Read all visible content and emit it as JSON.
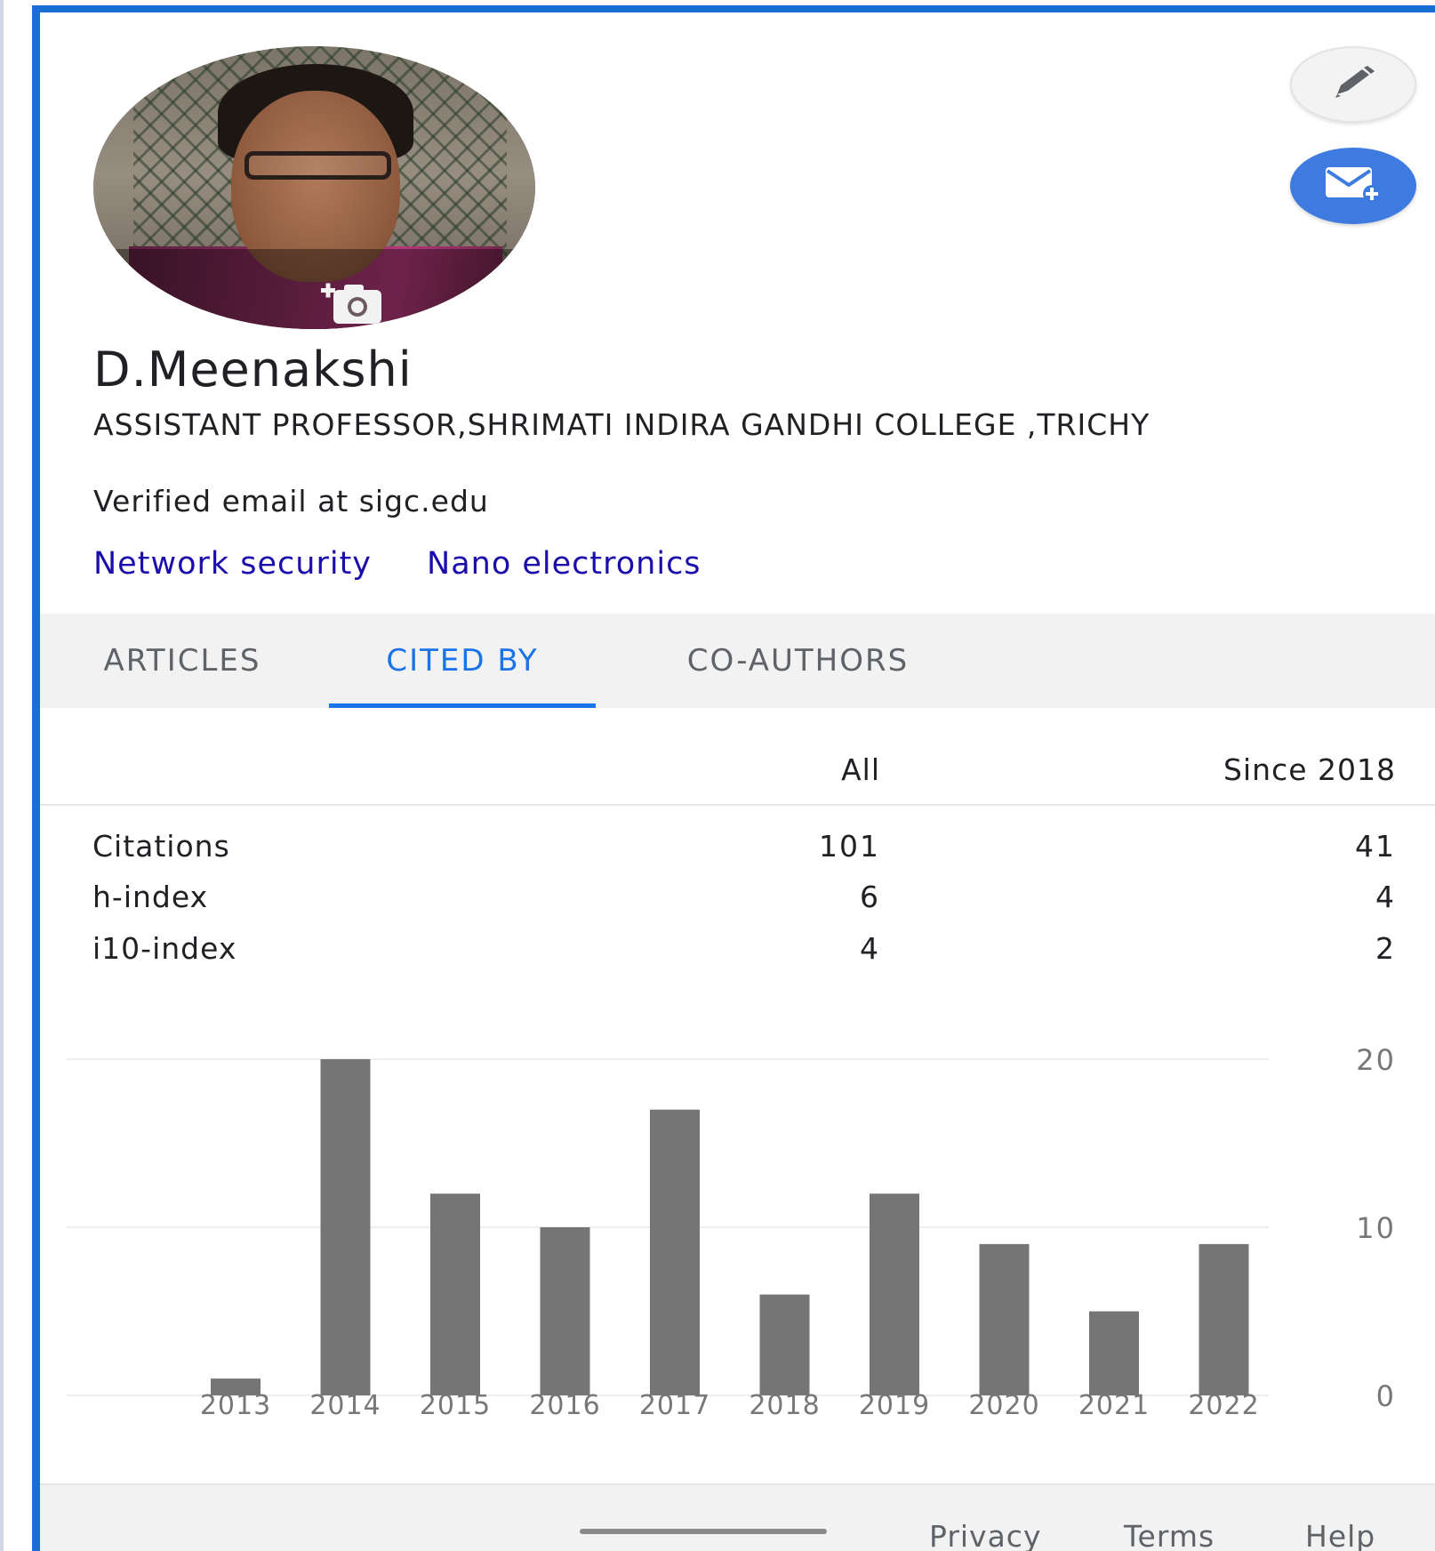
{
  "profile": {
    "name": "D.Meenakshi",
    "affiliation": "ASSISTANT PROFESSOR,SHRIMATI INDIRA GANDHI COLLEGE ,TRICHY",
    "email": "Verified email at sigc.edu",
    "interests": [
      "Network security",
      "Nano electronics"
    ]
  },
  "tabs": [
    {
      "label": "ARTICLES",
      "active": false
    },
    {
      "label": "CITED BY",
      "active": true
    },
    {
      "label": "CO-AUTHORS",
      "active": false
    }
  ],
  "stats": {
    "headers": {
      "all": "All",
      "since": "Since 2018"
    },
    "rows": [
      {
        "label": "Citations",
        "all": "101",
        "since": "41"
      },
      {
        "label": "h-index",
        "all": "6",
        "since": "4"
      },
      {
        "label": "i10-index",
        "all": "4",
        "since": "2"
      }
    ]
  },
  "chart_data": {
    "type": "bar",
    "categories": [
      "2013",
      "2014",
      "2015",
      "2016",
      "2017",
      "2018",
      "2019",
      "2020",
      "2021",
      "2022"
    ],
    "values": [
      1,
      20,
      12,
      10,
      17,
      6,
      12,
      9,
      5,
      9
    ],
    "yticks": [
      0,
      10,
      20
    ],
    "ylim": [
      0,
      20
    ],
    "bar_color": "#757575",
    "grid": true
  },
  "footer": {
    "links": [
      "Privacy",
      "Terms",
      "Help"
    ]
  },
  "icons": {
    "edit": "pencil-icon",
    "follow": "email-plus-icon",
    "photo": "add-photo-icon"
  },
  "colors": {
    "accent": "#1a73e8",
    "link": "#1a0dab",
    "follow_button": "#3d7be0"
  }
}
